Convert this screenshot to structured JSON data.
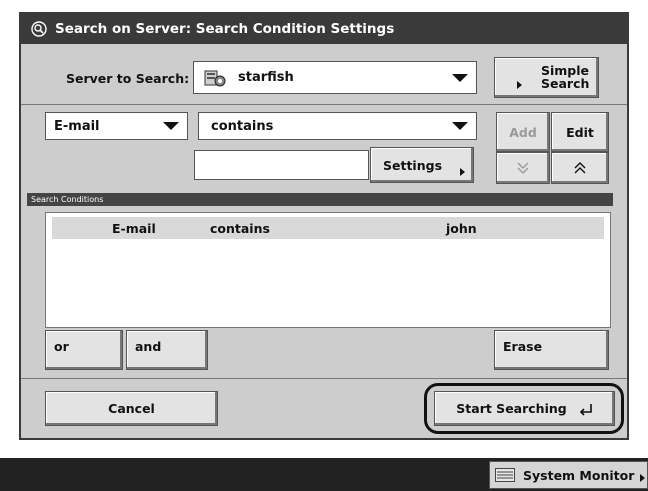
{
  "title": "Search on Server: Search Condition Settings",
  "server": {
    "label": "Server to Search:",
    "value": "starfish"
  },
  "simple_search": {
    "line1": "Simple",
    "line2": "Search"
  },
  "criteria": {
    "field_value": "E-mail",
    "operator_value": "contains",
    "text_value": "",
    "settings_label": "Settings"
  },
  "buttons": {
    "add": "Add",
    "edit": "Edit",
    "or": "or",
    "and": "and",
    "erase": "Erase",
    "cancel": "Cancel",
    "start": "Start Searching"
  },
  "conditions": {
    "header": "Search Conditions",
    "rows": [
      {
        "field": "E-mail",
        "operator": "contains",
        "value": "john"
      }
    ]
  },
  "system_monitor": "System Monitor"
}
